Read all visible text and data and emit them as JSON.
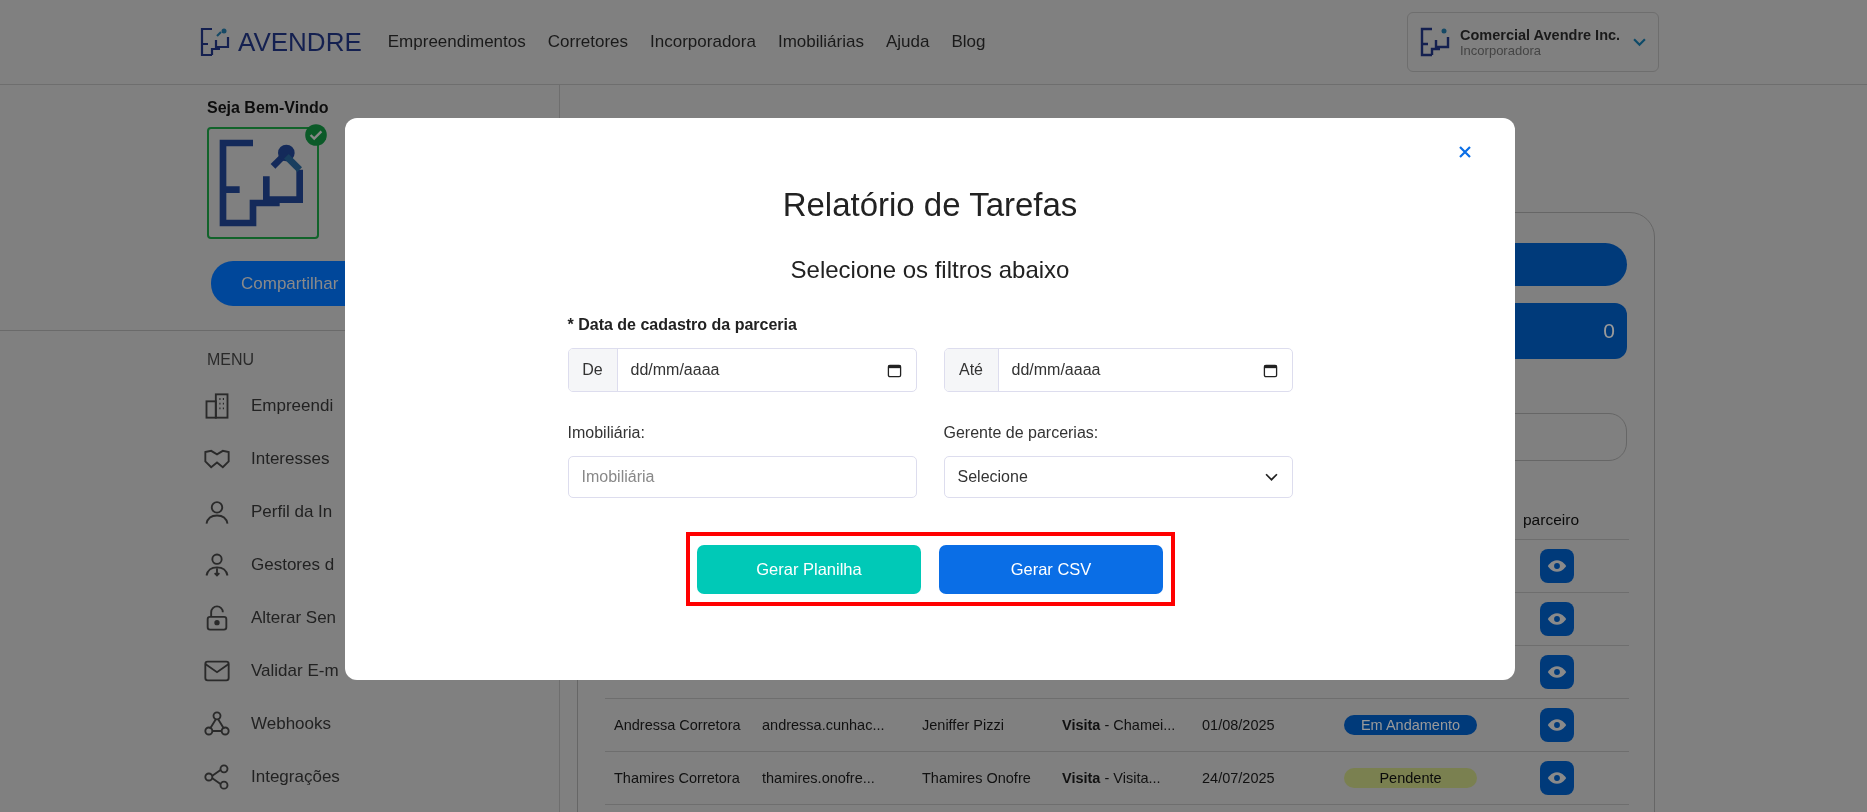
{
  "header": {
    "logo": "AVENDRE",
    "nav": [
      "Empreendimentos",
      "Corretores",
      "Incorporadora",
      "Imobiliárias",
      "Ajuda",
      "Blog"
    ],
    "account": {
      "name": "Comercial Avendre Inc.",
      "role": "Incorporadora"
    }
  },
  "sidebar": {
    "welcome": "Seja Bem-Vindo",
    "verified": true,
    "share_button": "Compartilhar",
    "menu_title": "MENU",
    "items": [
      {
        "label": "Empreendi"
      },
      {
        "label": "Interesses"
      },
      {
        "label": "Perfil da In"
      },
      {
        "label": "Gestores d"
      },
      {
        "label": "Alterar Sen"
      },
      {
        "label": "Validar E-m"
      },
      {
        "label": "Webhooks"
      },
      {
        "label": "Integrações"
      }
    ]
  },
  "main": {
    "counter": "0",
    "table": {
      "column_7": "parceiro",
      "rows": [
        {
          "kind": "covered"
        },
        {
          "kind": "covered"
        },
        {
          "kind": "covered"
        },
        {
          "kind": "full",
          "name": "Andressa Corretora",
          "email": "andressa.cunhac...",
          "manager": "Jeniffer Pizzi",
          "task": "**Visita** - Chamei...",
          "date": "01/08/2025",
          "status": {
            "label": "Em Andamento",
            "color": "#003a7a"
          }
        },
        {
          "kind": "full",
          "name": "Thamires Corretora",
          "email": "thamires.onofre...",
          "manager": "Thamires Onofre",
          "task": "**Visita** - Visita...",
          "date": "24/07/2025",
          "status": {
            "label": "Pendente",
            "color": "#7a8050"
          }
        }
      ]
    }
  },
  "modal": {
    "title": "Relatório de Tarefas",
    "subtitle": "Selecione os filtros abaixo",
    "date_label": "* Data de cadastro da parceria",
    "date_from": {
      "prefix": "De",
      "value": "dd/mm/aaaa"
    },
    "date_to": {
      "prefix": "Até",
      "value": "dd/mm/aaaa"
    },
    "agency": {
      "label": "Imobiliária:",
      "placeholder": "Imobiliária"
    },
    "manager": {
      "label": "Gerente de parcerias:",
      "value": "Selecione"
    },
    "buttons_highlighted": true,
    "buttons": [
      {
        "kind": "spreadsheet",
        "label": "Gerar Planilha"
      },
      {
        "kind": "csv",
        "label": "Gerar CSV"
      }
    ]
  }
}
